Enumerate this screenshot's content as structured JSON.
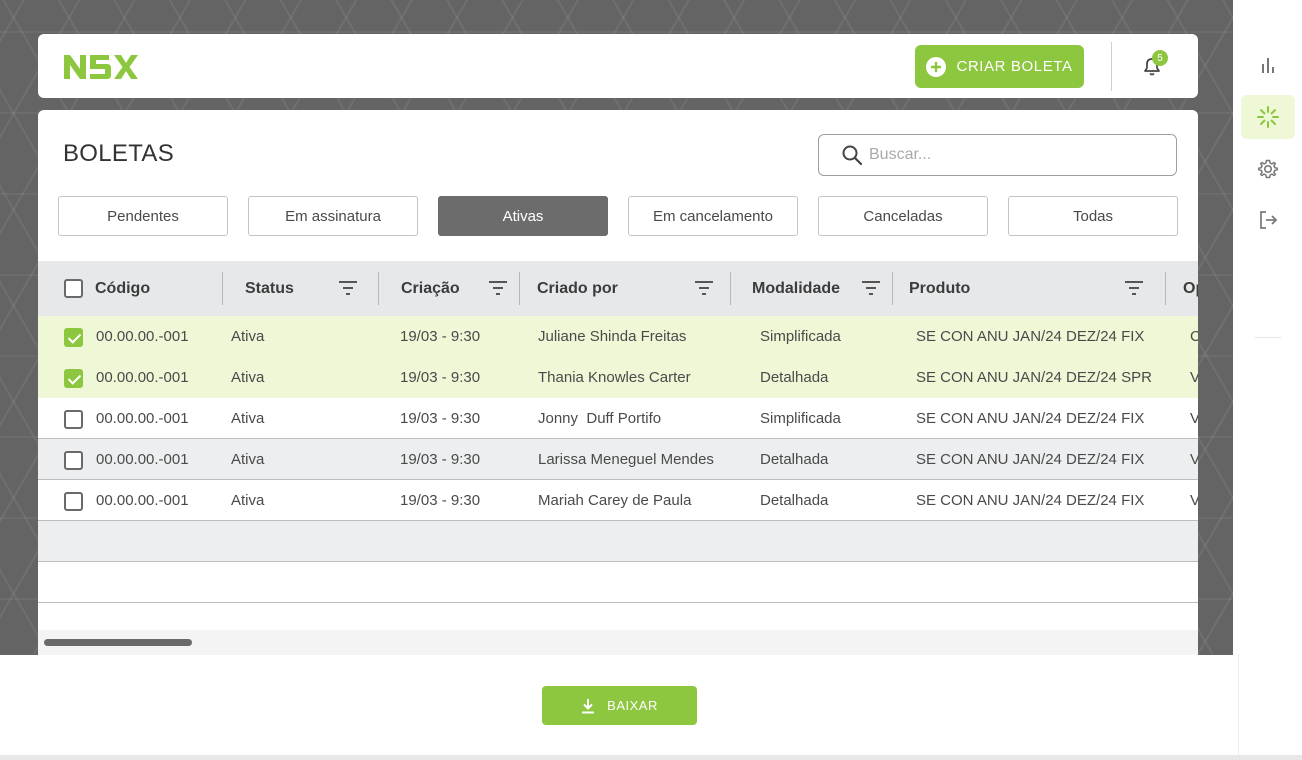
{
  "colors": {
    "accent": "#8dc63f",
    "selected_row": "#eef8d6",
    "active_tab": "#6c6c6c"
  },
  "header": {
    "logo": "N5X",
    "create_button": "CRIAR BOLETA",
    "notification_count": "5"
  },
  "main": {
    "title": "BOLETAS",
    "search_placeholder": "Buscar..."
  },
  "tabs": [
    {
      "label": "Pendentes"
    },
    {
      "label": "Em assinatura"
    },
    {
      "label": "Ativas",
      "active": true
    },
    {
      "label": "Em cancelamento"
    },
    {
      "label": "Canceladas"
    },
    {
      "label": "Todas"
    }
  ],
  "table": {
    "columns": [
      "Código",
      "Status",
      "Criação",
      "Criado por",
      "Modalidade",
      "Produto",
      "Op"
    ],
    "rows": [
      {
        "checked": true,
        "codigo": "00.00.00.-001",
        "status": "Ativa",
        "criacao": "19/03 - 9:30",
        "criado_por": "Juliane Shinda Freitas",
        "modalidade": "Simplificada",
        "produto": "SE CON ANU JAN/24 DEZ/24 FIX",
        "op": "C"
      },
      {
        "checked": true,
        "codigo": "00.00.00.-001",
        "status": "Ativa",
        "criacao": "19/03 - 9:30",
        "criado_por": "Thania Knowles Carter",
        "modalidade": "Detalhada",
        "produto": "SE CON ANU JAN/24 DEZ/24 SPR",
        "op": "V"
      },
      {
        "checked": false,
        "codigo": "00.00.00.-001",
        "status": "Ativa",
        "criacao": "19/03 - 9:30",
        "criado_por": "Jonny  Duff Portifo",
        "modalidade": "Simplificada",
        "produto": "SE CON ANU JAN/24 DEZ/24 FIX",
        "op": "V"
      },
      {
        "checked": false,
        "codigo": "00.00.00.-001",
        "status": "Ativa",
        "criacao": "19/03 - 9:30",
        "criado_por": "Larissa Meneguel Mendes",
        "modalidade": "Detalhada",
        "produto": "SE CON ANU JAN/24 DEZ/24 FIX",
        "op": "V"
      },
      {
        "checked": false,
        "codigo": "00.00.00.-001",
        "status": "Ativa",
        "criacao": "19/03 - 9:30",
        "criado_por": "Mariah Carey de Paula",
        "modalidade": "Detalhada",
        "produto": "SE CON ANU JAN/24 DEZ/24 FIX",
        "op": "V"
      }
    ]
  },
  "footer": {
    "download_button": "BAIXAR"
  },
  "rail": {
    "items": [
      "chart-icon",
      "loading-icon",
      "gear-icon",
      "logout-icon"
    ]
  }
}
